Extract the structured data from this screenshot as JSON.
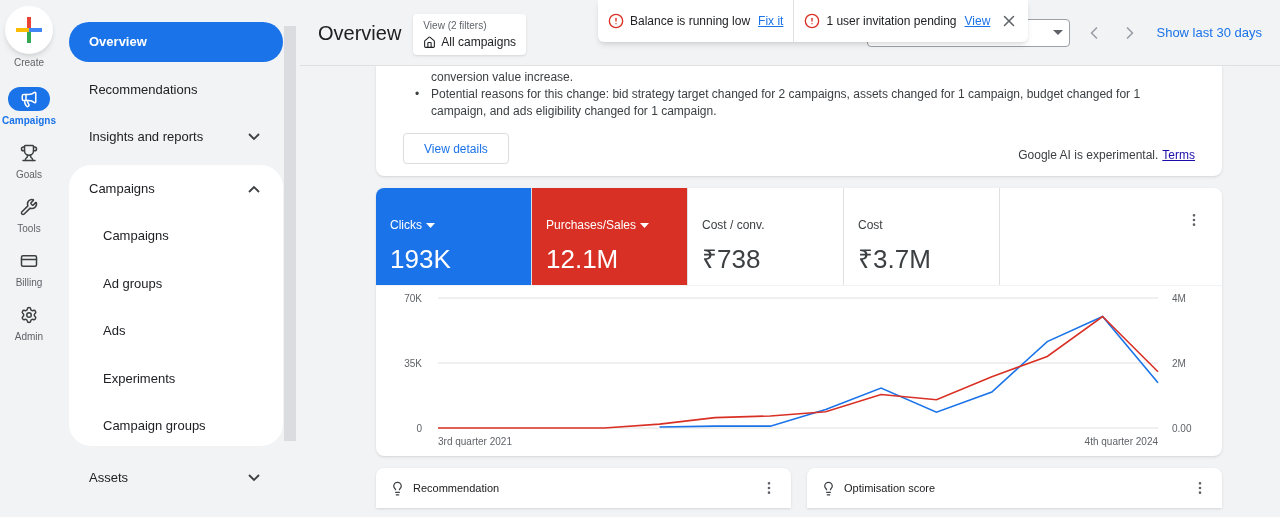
{
  "rail": [
    {
      "label": "Create",
      "kind": "create",
      "selected": false
    },
    {
      "label": "Campaigns",
      "kind": "campaigns",
      "selected": true
    },
    {
      "label": "Goals",
      "kind": "goals",
      "selected": false
    },
    {
      "label": "Tools",
      "kind": "tools",
      "selected": false
    },
    {
      "label": "Billing",
      "kind": "billing",
      "selected": false
    },
    {
      "label": "Admin",
      "kind": "admin",
      "selected": false
    }
  ],
  "nav": [
    {
      "label": "Overview",
      "selected": true
    },
    {
      "label": "Recommendations",
      "selected": false
    },
    {
      "label": "Insights and reports",
      "selected": false,
      "expanded": false
    },
    {
      "label": "Campaigns",
      "selected": false,
      "expanded": true,
      "children": [
        {
          "label": "Campaigns",
          "selected": false
        },
        {
          "label": "Ad groups",
          "selected": false
        },
        {
          "label": "Ads",
          "selected": false
        },
        {
          "label": "Experiments",
          "selected": false
        },
        {
          "label": "Campaign groups",
          "selected": false
        }
      ]
    },
    {
      "label": "Assets",
      "selected": false,
      "expanded": false
    }
  ],
  "header": {
    "title": "Overview",
    "filter_caption": "View (2 filters)",
    "filter_value": "All campaigns",
    "show_last": "Show last 30 days"
  },
  "toast": {
    "items": [
      {
        "message": "Balance is running low",
        "action": "Fix it"
      },
      {
        "message": "1 user invitation pending",
        "action": "View"
      }
    ]
  },
  "summary": {
    "bullets": [
      {
        "text": "conversion value increase."
      },
      {
        "marker": "•",
        "text": "Potential reasons for this change: bid strategy target changed for 2 campaigns, assets changed for 1 campaign, budget changed for 1 campaign, and ads eligibility changed for 1 campaign."
      }
    ],
    "button": "View details",
    "note": "Google AI is experimental.",
    "link": "Terms"
  },
  "metrics": [
    {
      "label": "Clicks",
      "value": "193K",
      "selected": true,
      "color": "#1a73e8",
      "dropdown": true
    },
    {
      "label": "Purchases/Sales",
      "value": "12.1M",
      "selected": true,
      "color": "#d93025",
      "dropdown": true
    },
    {
      "label": "Cost / conv.",
      "value": "₹738",
      "selected": false,
      "dropdown": false
    },
    {
      "label": "Cost",
      "value": "₹3.7M",
      "selected": false,
      "dropdown": false
    }
  ],
  "chart": {
    "x_axis_labels": {
      "start": "3rd quarter 2021",
      "end": "4th quarter 2024"
    },
    "left": {
      "chart_data": {
        "type": "line",
        "ylim": [
          0,
          70000
        ],
        "yticks": [
          {
            "value": 0,
            "label": "0"
          },
          {
            "value": 35000,
            "label": "35K"
          },
          {
            "value": 70000,
            "label": "70K"
          }
        ],
        "series": [
          {
            "color": "#1a73e8",
            "values": [
              null,
              null,
              null,
              null,
              500,
              1000,
              1000,
              10000,
              21500,
              8500,
              19400,
              46500,
              60000,
              24400
            ]
          }
        ]
      }
    },
    "right": {
      "chart_data": {
        "type": "line",
        "ylim": [
          0,
          4000000
        ],
        "yticks": [
          {
            "value": 0,
            "label": "0.00"
          },
          {
            "value": 2000000,
            "label": "2M"
          },
          {
            "value": 4000000,
            "label": "4M"
          }
        ],
        "series": [
          {
            "color": "#d93025",
            "values": [
              0,
              0,
              0,
              0,
              120000,
              320000,
              370000,
              500000,
              1030000,
              870000,
              1580000,
              2200000,
              3430000,
              1730000
            ]
          }
        ]
      }
    }
  },
  "bottom_cards": [
    {
      "title": "Recommendation"
    },
    {
      "title": "Optimisation score"
    }
  ]
}
